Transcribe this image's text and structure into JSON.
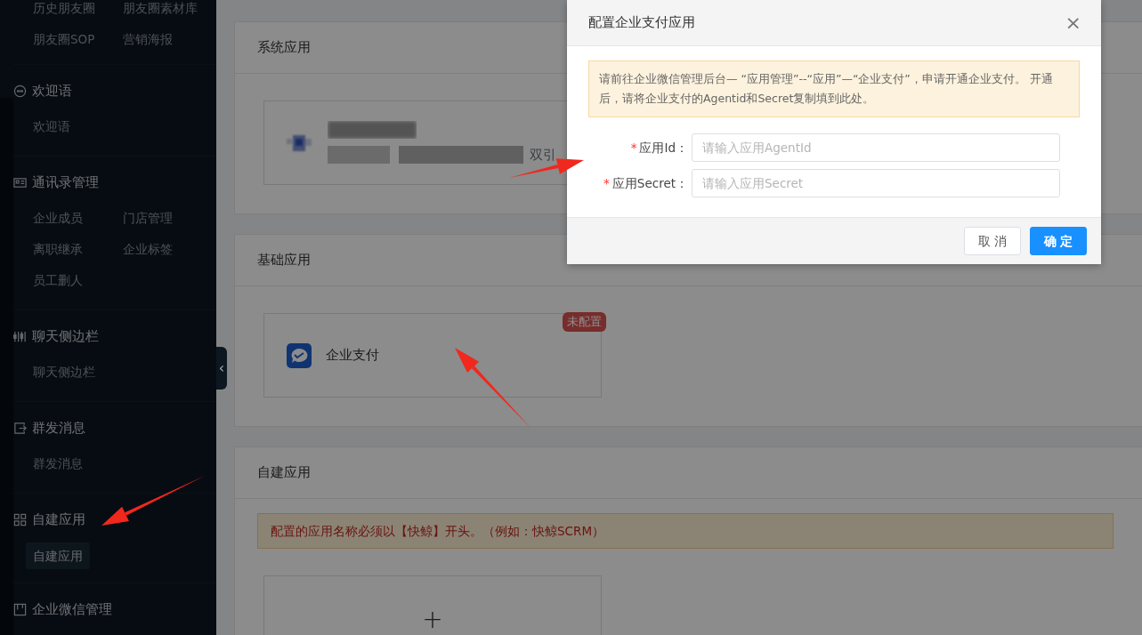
{
  "sidebar": {
    "groups": [
      {
        "items": [
          {
            "label": "历史朋友圈",
            "selected": false
          },
          {
            "label": "朋友圈素材库",
            "selected": false
          },
          {
            "label": "朋友圈SOP",
            "selected": false
          },
          {
            "label": "营销海报",
            "selected": false
          }
        ]
      },
      {
        "title": "欢迎语",
        "items": [
          {
            "label": "欢迎语",
            "selected": false
          }
        ]
      },
      {
        "title": "通讯录管理",
        "items": [
          {
            "label": "企业成员",
            "selected": false
          },
          {
            "label": "门店管理",
            "selected": false
          },
          {
            "label": "离职继承",
            "selected": false
          },
          {
            "label": "企业标签",
            "selected": false
          },
          {
            "label": "员工删人",
            "selected": false
          }
        ]
      },
      {
        "title": "聊天侧边栏",
        "items": [
          {
            "label": "聊天侧边栏",
            "selected": false
          }
        ]
      },
      {
        "title": "群发消息",
        "items": [
          {
            "label": "群发消息",
            "selected": false
          }
        ]
      },
      {
        "title": "自建应用",
        "items": [
          {
            "label": "自建应用",
            "selected": true
          }
        ]
      },
      {
        "title": "企业微信管理"
      }
    ],
    "collapse_handle": "‹"
  },
  "sections": [
    {
      "title": "系统应用",
      "apps": [
        {
          "kind": "blurred",
          "name": "双引"
        }
      ]
    },
    {
      "title": "基础应用",
      "apps": [
        {
          "kind": "app",
          "name": "企业支付",
          "badge": "未配置"
        }
      ]
    },
    {
      "title": "自建应用",
      "notice": "配置的应用名称必须以【快鲸】开头。（例如：快鲸SCRM）",
      "apps": [
        {
          "kind": "add",
          "name": "+"
        }
      ]
    }
  ],
  "dialog": {
    "title": "配置企业支付应用",
    "close": "×",
    "notice": "请前往企业微信管理后台— “应用管理”--“应用”—“企业支付”，申请开通企业支付。 开通后，请将企业支付的Agentid和Secret复制填到此处。",
    "required_symbol": "*",
    "fields": [
      {
        "label": "应用Id：",
        "required": true,
        "placeholder": "请输入应用AgentId"
      },
      {
        "label": "应用Secret：",
        "required": true,
        "placeholder": "请输入应用Secret"
      }
    ],
    "buttons": [
      {
        "label": "取 消",
        "kind": "default"
      },
      {
        "label": "确 定",
        "kind": "primary"
      }
    ]
  }
}
